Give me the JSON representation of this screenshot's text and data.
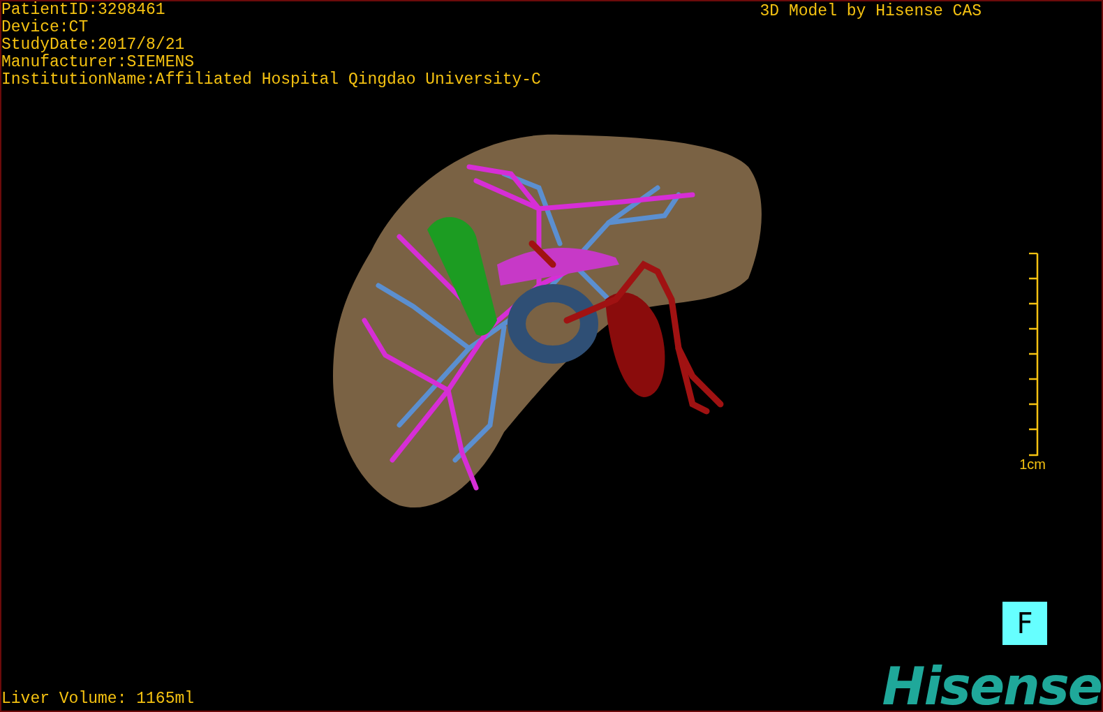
{
  "patient_info": [
    "PatientID:3298461",
    "Device:CT",
    "StudyDate:2017/8/21",
    "Manufacturer:SIEMENS",
    "InstitutionName:Affiliated Hospital Qingdao University-C"
  ],
  "title": "3D Model by Hisense CAS",
  "scale_bar": {
    "label": "1cm"
  },
  "orientation_marker": "F",
  "liver_volume": "Liver Volume: 1165ml",
  "logo": "Hisense"
}
